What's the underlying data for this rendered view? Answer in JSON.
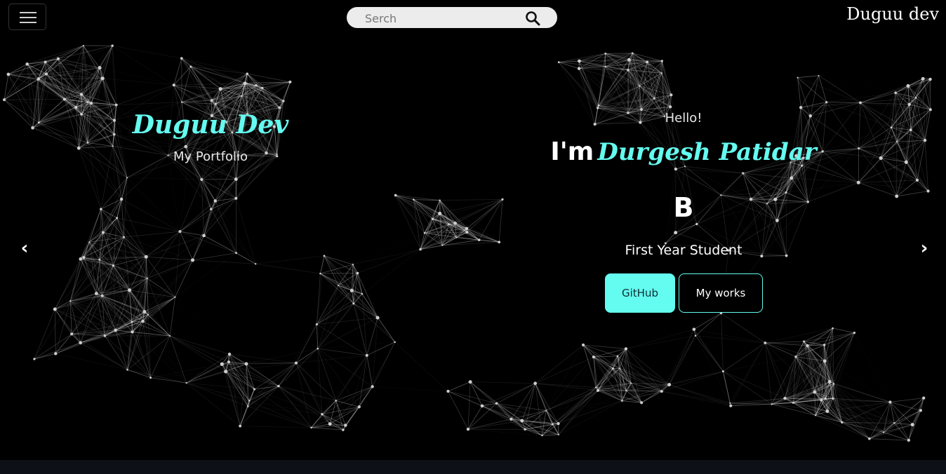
{
  "header": {
    "search_placeholder": "Serch",
    "brand": "Duguu dev"
  },
  "hero_left": {
    "title": "Duguu Dev",
    "subtitle": "My Portfolio"
  },
  "hero_right": {
    "greeting": "Hello!",
    "intro_prefix": "I'm",
    "name": "Durgesh Patidar",
    "typing_text": "B",
    "role": "First Year Student"
  },
  "buttons": {
    "github": "GitHub",
    "works": "My works"
  },
  "carousel": {
    "prev": "‹",
    "next": "›"
  },
  "colors": {
    "accent": "#64fbf0",
    "background": "#000000",
    "bottom_strip": "#0d1117"
  },
  "icons": {
    "menu": "hamburger-menu-icon",
    "search": "search-icon",
    "prev": "chevron-left-icon",
    "next": "chevron-right-icon"
  }
}
